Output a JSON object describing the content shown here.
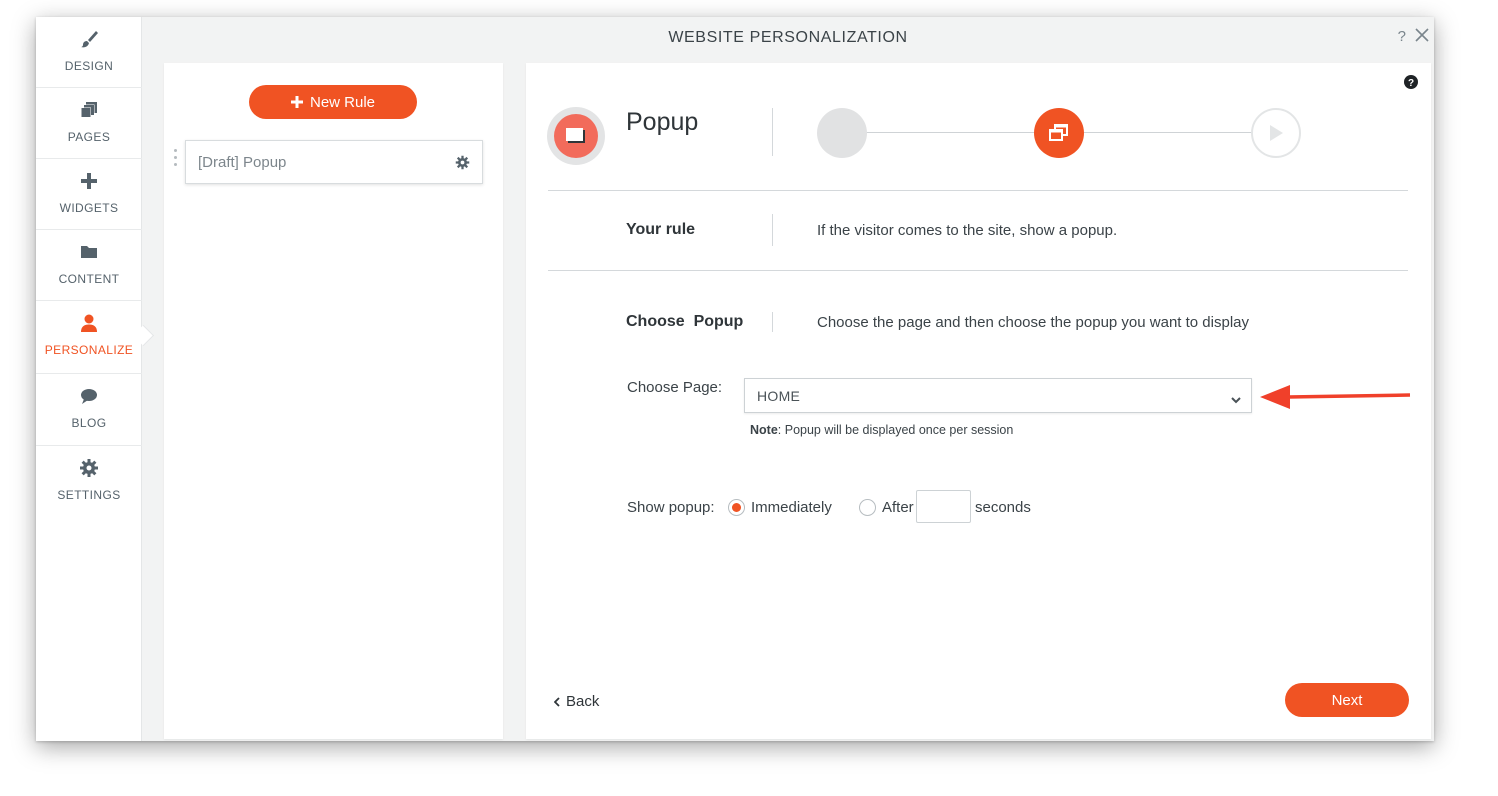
{
  "window": {
    "title": "WEBSITE PERSONALIZATION",
    "help_label": "?"
  },
  "sidebar": {
    "items": [
      {
        "label": "DESIGN",
        "icon": "brush-icon"
      },
      {
        "label": "PAGES",
        "icon": "pages-icon"
      },
      {
        "label": "WIDGETS",
        "icon": "plus-icon"
      },
      {
        "label": "CONTENT",
        "icon": "folder-icon"
      },
      {
        "label": "PERSONALIZE",
        "icon": "person-icon",
        "active": true
      },
      {
        "label": "BLOG",
        "icon": "chat-bubble-icon"
      },
      {
        "label": "SETTINGS",
        "icon": "gear-icon"
      }
    ]
  },
  "rules": {
    "new_rule_label": "New Rule",
    "items": [
      {
        "name": "[Draft] Popup"
      }
    ]
  },
  "main": {
    "type_title": "Popup",
    "steps": [
      "filter",
      "popup",
      "play"
    ],
    "active_step": 2,
    "your_rule": {
      "label": "Your rule",
      "text": "If the visitor comes to the site, show a popup."
    },
    "choose_popup": {
      "label": "Choose  Popup",
      "text": "Choose the page and then choose the popup you want to display"
    },
    "choose_page": {
      "label": "Choose Page:",
      "selected": "HOME"
    },
    "note": {
      "bold": "Note",
      "text": ": Popup will be displayed once per session"
    },
    "show_popup": {
      "label": "Show popup:",
      "options": [
        "Immediately",
        "After"
      ],
      "selected": "Immediately",
      "seconds_value": "",
      "seconds_label": "seconds"
    },
    "back_label": "Back",
    "next_label": "Next"
  },
  "colors": {
    "accent": "#f05323",
    "annotation_arrow": "#f0402a"
  }
}
